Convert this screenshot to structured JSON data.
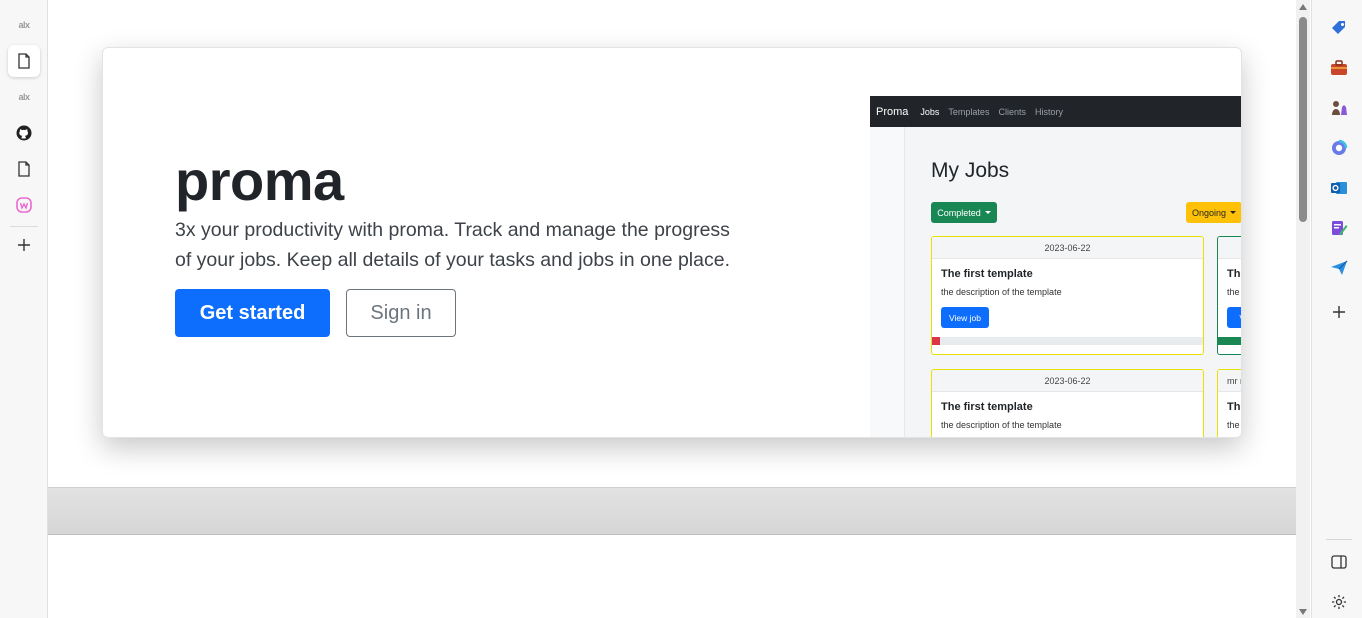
{
  "left_strip": {
    "items": [
      {
        "label": "alx",
        "icon": "alx-logo"
      },
      {
        "icon": "page-icon",
        "active": true
      },
      {
        "label": "alx",
        "icon": "alx-logo"
      },
      {
        "icon": "github-icon"
      },
      {
        "icon": "page-icon"
      },
      {
        "icon": "w-app-icon"
      },
      {
        "icon": "plus-icon"
      }
    ]
  },
  "hero": {
    "title": "proma",
    "description": "3x your productivity with proma. Track and manage the progress of your jobs. Keep all details of your tasks and jobs in one place.",
    "primary_button": "Get started",
    "secondary_button": "Sign in"
  },
  "preview": {
    "brand": "Proma",
    "nav_links": [
      "Jobs",
      "Templates",
      "Clients",
      "History"
    ],
    "active_link": "Jobs",
    "heading": "My Jobs",
    "filter_completed": "Completed",
    "filter_ongoing": "Ongoing",
    "cards": [
      {
        "date": "2023-06-22",
        "title": "The first template",
        "description": "the description of the template",
        "button": "View job",
        "progress": 0.03,
        "progress_color": "#dc3545"
      },
      {
        "date": "",
        "title": "The",
        "description": "the",
        "button": "V",
        "progress": 0.9,
        "progress_color": "#198754"
      },
      {
        "date": "2023-06-22",
        "title": "The first template",
        "description": "the description of the template"
      },
      {
        "date": "mr r",
        "title": "The",
        "description": "the"
      }
    ]
  },
  "right_strip": {
    "icons": [
      "tag-icon",
      "toolbox-icon",
      "chess-icon",
      "copilot-icon",
      "outlook-icon",
      "designer-icon",
      "send-icon",
      "plus-icon",
      "sidebar-toggle-icon",
      "settings-icon"
    ]
  },
  "colors": {
    "primary": "#0d6efd",
    "success": "#198754",
    "warning": "#ffc107",
    "dark_nav": "#212529"
  }
}
